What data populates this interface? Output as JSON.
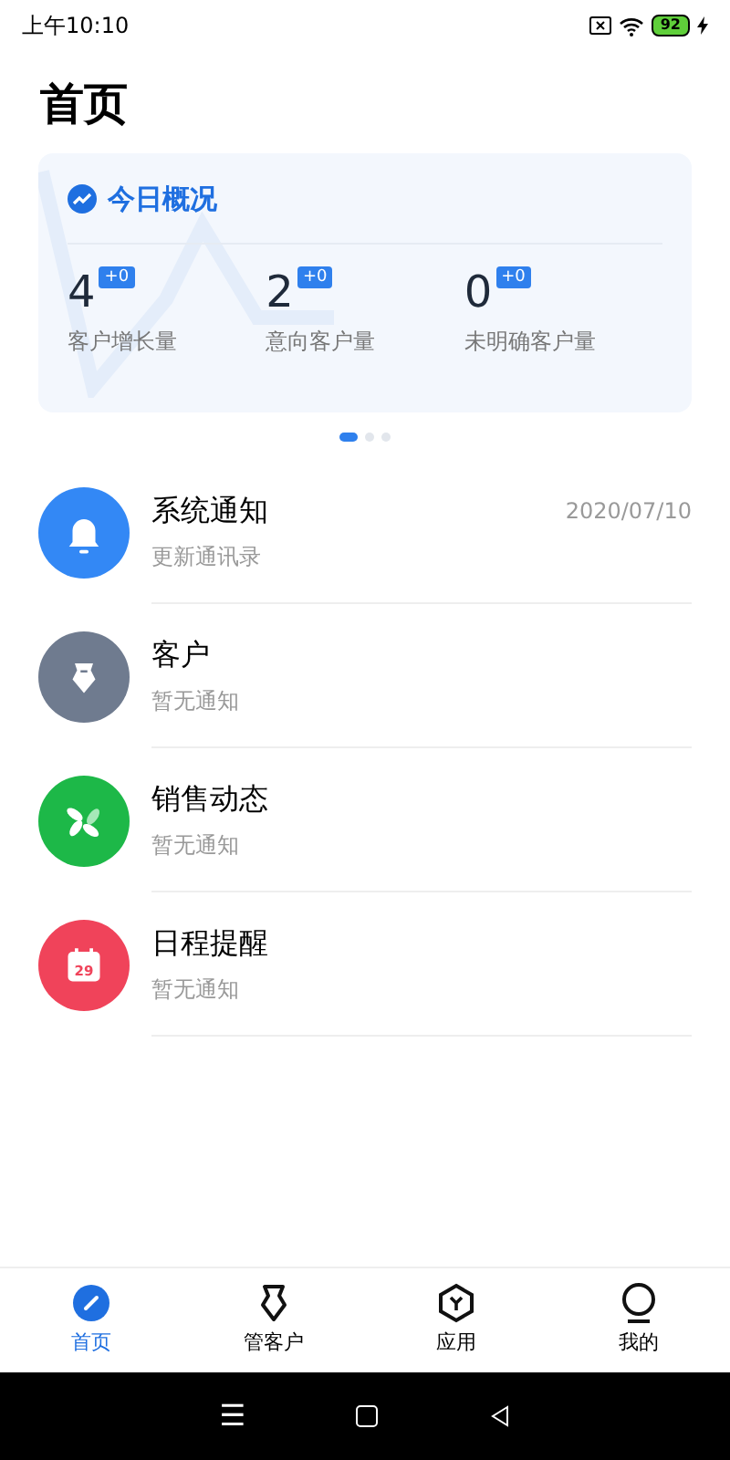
{
  "status_bar": {
    "time": "上午10:10",
    "battery": "92"
  },
  "title": "首页",
  "overview": {
    "title": "今日概况",
    "stats": [
      {
        "value": "4",
        "delta": "+0",
        "label": "客户增长量"
      },
      {
        "value": "2",
        "delta": "+0",
        "label": "意向客户量"
      },
      {
        "value": "0",
        "delta": "+0",
        "label": "未明确客户量"
      }
    ]
  },
  "pager": [
    {
      "selected": true
    },
    {
      "selected": false
    },
    {
      "selected": false
    }
  ],
  "messages": [
    {
      "kind": "bell",
      "color": "#3388f5",
      "title": "系统通知",
      "subtitle": "更新通讯录",
      "date": "2020/07/10"
    },
    {
      "kind": "badge",
      "color": "#6f7b8f",
      "title": "客户",
      "subtitle": "暂无通知"
    },
    {
      "kind": "pinwheel",
      "color": "#1db848",
      "title": "销售动态",
      "subtitle": "暂无通知"
    },
    {
      "kind": "calendar",
      "color": "#f0435a",
      "title": "日程提醒",
      "subtitle": "暂无通知",
      "icon_text": "29"
    }
  ],
  "tabs": [
    {
      "kind": "pen",
      "label": "首页",
      "selected": true
    },
    {
      "kind": "badge",
      "label": "管客户",
      "selected": false
    },
    {
      "kind": "hexagon",
      "label": "应用",
      "selected": false
    },
    {
      "kind": "person",
      "label": "我的",
      "selected": false
    }
  ],
  "nav_bar": {
    "menu": "☰"
  }
}
